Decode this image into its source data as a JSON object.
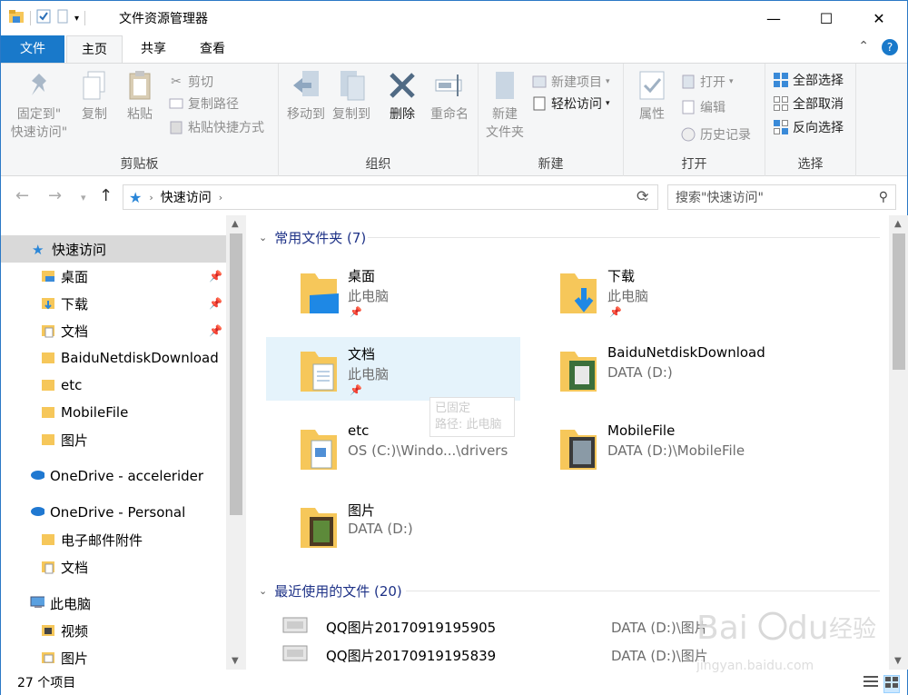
{
  "titlebar": {
    "title": "文件资源管理器",
    "minimize_label": "—",
    "maximize_label": "☐",
    "close_label": "✕"
  },
  "tabs": {
    "file": "文件",
    "home": "主页",
    "share": "共享",
    "view": "查看"
  },
  "ribbon": {
    "clipboard": {
      "label": "剪贴板",
      "pin_quick_line1": "固定到\"",
      "pin_quick_line2": "快速访问\"",
      "copy": "复制",
      "paste": "粘贴",
      "cut": "剪切",
      "copy_path": "复制路径",
      "paste_shortcut": "粘贴快捷方式"
    },
    "organize": {
      "label": "组织",
      "move_to": "移动到",
      "copy_to": "复制到",
      "delete": "删除",
      "rename": "重命名"
    },
    "new": {
      "label": "新建",
      "new_folder_line1": "新建",
      "new_folder_line2": "文件夹",
      "new_item": "新建项目",
      "easy_access": "轻松访问"
    },
    "open": {
      "label": "打开",
      "properties": "属性",
      "open": "打开",
      "edit": "编辑",
      "history": "历史记录"
    },
    "select": {
      "label": "选择",
      "select_all": "全部选择",
      "select_none": "全部取消",
      "invert": "反向选择"
    }
  },
  "address": {
    "path": "快速访问",
    "search_placeholder": "搜索\"快速访问\""
  },
  "navpane": {
    "items": [
      {
        "label": "快速访问"
      },
      {
        "label": "桌面"
      },
      {
        "label": "下载"
      },
      {
        "label": "文档"
      },
      {
        "label": "BaiduNetdiskDownload"
      },
      {
        "label": "etc"
      },
      {
        "label": "MobileFile"
      },
      {
        "label": "图片"
      },
      {
        "label": "OneDrive - accelerider"
      },
      {
        "label": "OneDrive - Personal"
      },
      {
        "label": "电子邮件附件"
      },
      {
        "label": "文档"
      },
      {
        "label": "此电脑"
      },
      {
        "label": "视频"
      },
      {
        "label": "图片"
      }
    ]
  },
  "content": {
    "frequent_header": "常用文件夹 (7)",
    "recent_header": "最近使用的文件 (20)",
    "folders": [
      {
        "name": "桌面",
        "location": "此电脑"
      },
      {
        "name": "下载",
        "location": "此电脑"
      },
      {
        "name": "文档",
        "location": "此电脑"
      },
      {
        "name": "BaiduNetdiskDownload",
        "location": "DATA (D:)"
      },
      {
        "name": "etc",
        "location": "OS (C:)\\Windo...\\drivers"
      },
      {
        "name": "MobileFile",
        "location": "DATA (D:)\\MobileFile"
      },
      {
        "name": "图片",
        "location": "DATA (D:)"
      }
    ],
    "tooltip_line1": "已固定",
    "tooltip_line2": "路径: 此电脑",
    "recent_files": [
      {
        "name": "QQ图片20170919195905",
        "path": "DATA (D:)\\图片"
      },
      {
        "name": "QQ图片20170919195839",
        "path": "DATA (D:)\\图片"
      }
    ]
  },
  "statusbar": {
    "count": "27 个项目"
  },
  "watermark": {
    "brand": "Baidu经验",
    "url": "jingyan.baidu.com"
  },
  "colors": {
    "accent": "#1979ca",
    "folder": "#f6c75a",
    "hover": "#e5f3fb"
  }
}
